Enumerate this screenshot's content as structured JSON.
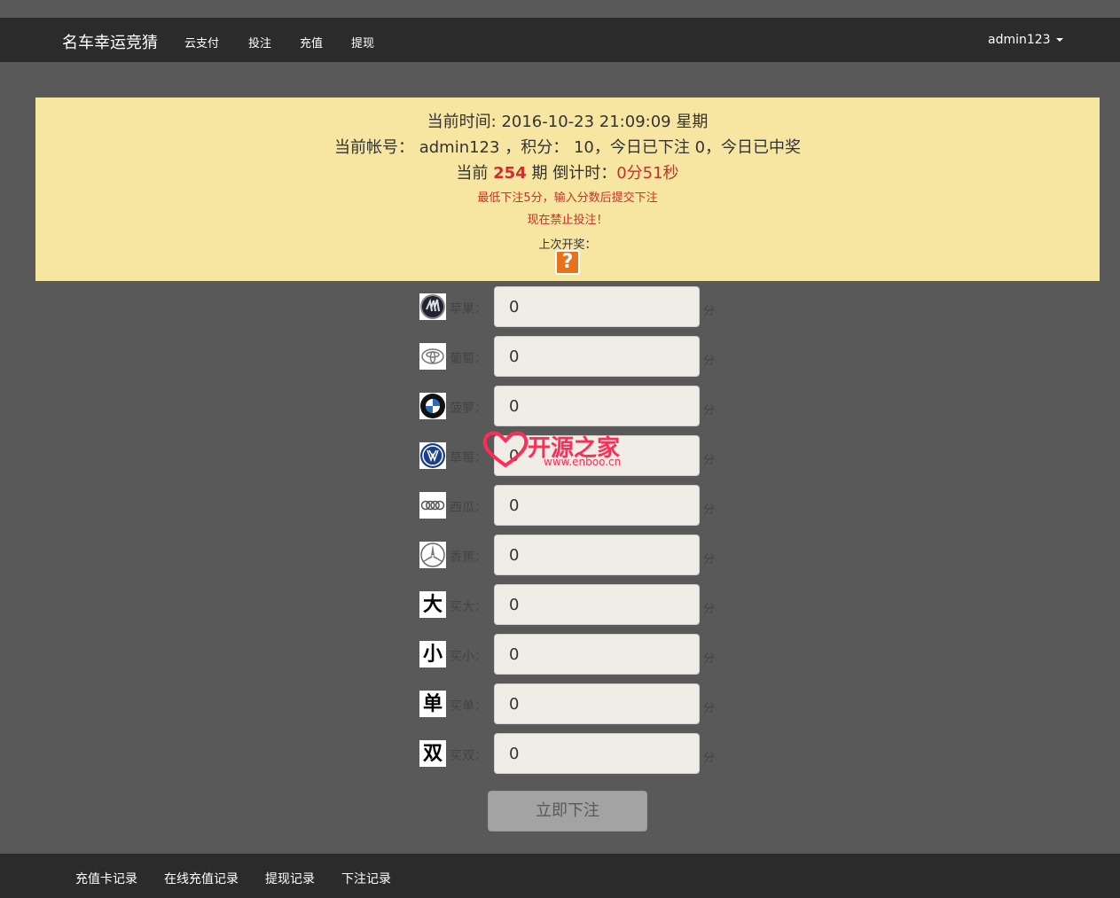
{
  "header": {
    "brand": "名车幸运竞猜",
    "nav": [
      "云支付",
      "投注",
      "充值",
      "提现"
    ],
    "user": "admin123"
  },
  "info": {
    "time_label": "当前时间:",
    "time_value": "2016-10-23  21:09:09",
    "weekday_label": "星期",
    "account_label": "当前帐号：",
    "account_value": "admin123",
    "points_label": "，积分：",
    "points_value": "10",
    "today_bet_label": "，今日已下注",
    "today_bet_value": "0",
    "today_win_label": "，今日已中奖",
    "period_prefix": "当前",
    "period_number": "254",
    "period_suffix": "期 倒计时：",
    "countdown": "0分51秒",
    "min_bet_note": "最低下注5分，输入分数后提交下注",
    "forbidden_note": "现在禁止投注！",
    "last_draw_label": "上次开奖：",
    "last_draw_icon": "question-mark-icon"
  },
  "bets": [
    {
      "label": "苹果：",
      "value": "0",
      "unit": "分",
      "icon": "buick-logo"
    },
    {
      "label": "葡萄：",
      "value": "0",
      "unit": "分",
      "icon": "toyota-logo"
    },
    {
      "label": "菠萝：",
      "value": "0",
      "unit": "分",
      "icon": "bmw-logo"
    },
    {
      "label": "草莓：",
      "value": "0",
      "unit": "分",
      "icon": "volkswagen-logo"
    },
    {
      "label": "西瓜：",
      "value": "0",
      "unit": "分",
      "icon": "audi-logo"
    },
    {
      "label": "香蕉：",
      "value": "0",
      "unit": "分",
      "icon": "mercedes-logo"
    },
    {
      "label": "买大：",
      "value": "0",
      "unit": "分",
      "icon": "char-da",
      "glyph": "大"
    },
    {
      "label": "买小：",
      "value": "0",
      "unit": "分",
      "icon": "char-xiao",
      "glyph": "小"
    },
    {
      "label": "买单：",
      "value": "0",
      "unit": "分",
      "icon": "char-dan",
      "glyph": "单"
    },
    {
      "label": "买双：",
      "value": "0",
      "unit": "分",
      "icon": "char-shuang",
      "glyph": "双"
    }
  ],
  "submit_label": "立即下注",
  "footer": [
    "充值卡记录",
    "在线充值记录",
    "提现记录",
    "下注记录"
  ],
  "watermark": {
    "title": "开源之家",
    "url": "www.enboo.cn"
  }
}
